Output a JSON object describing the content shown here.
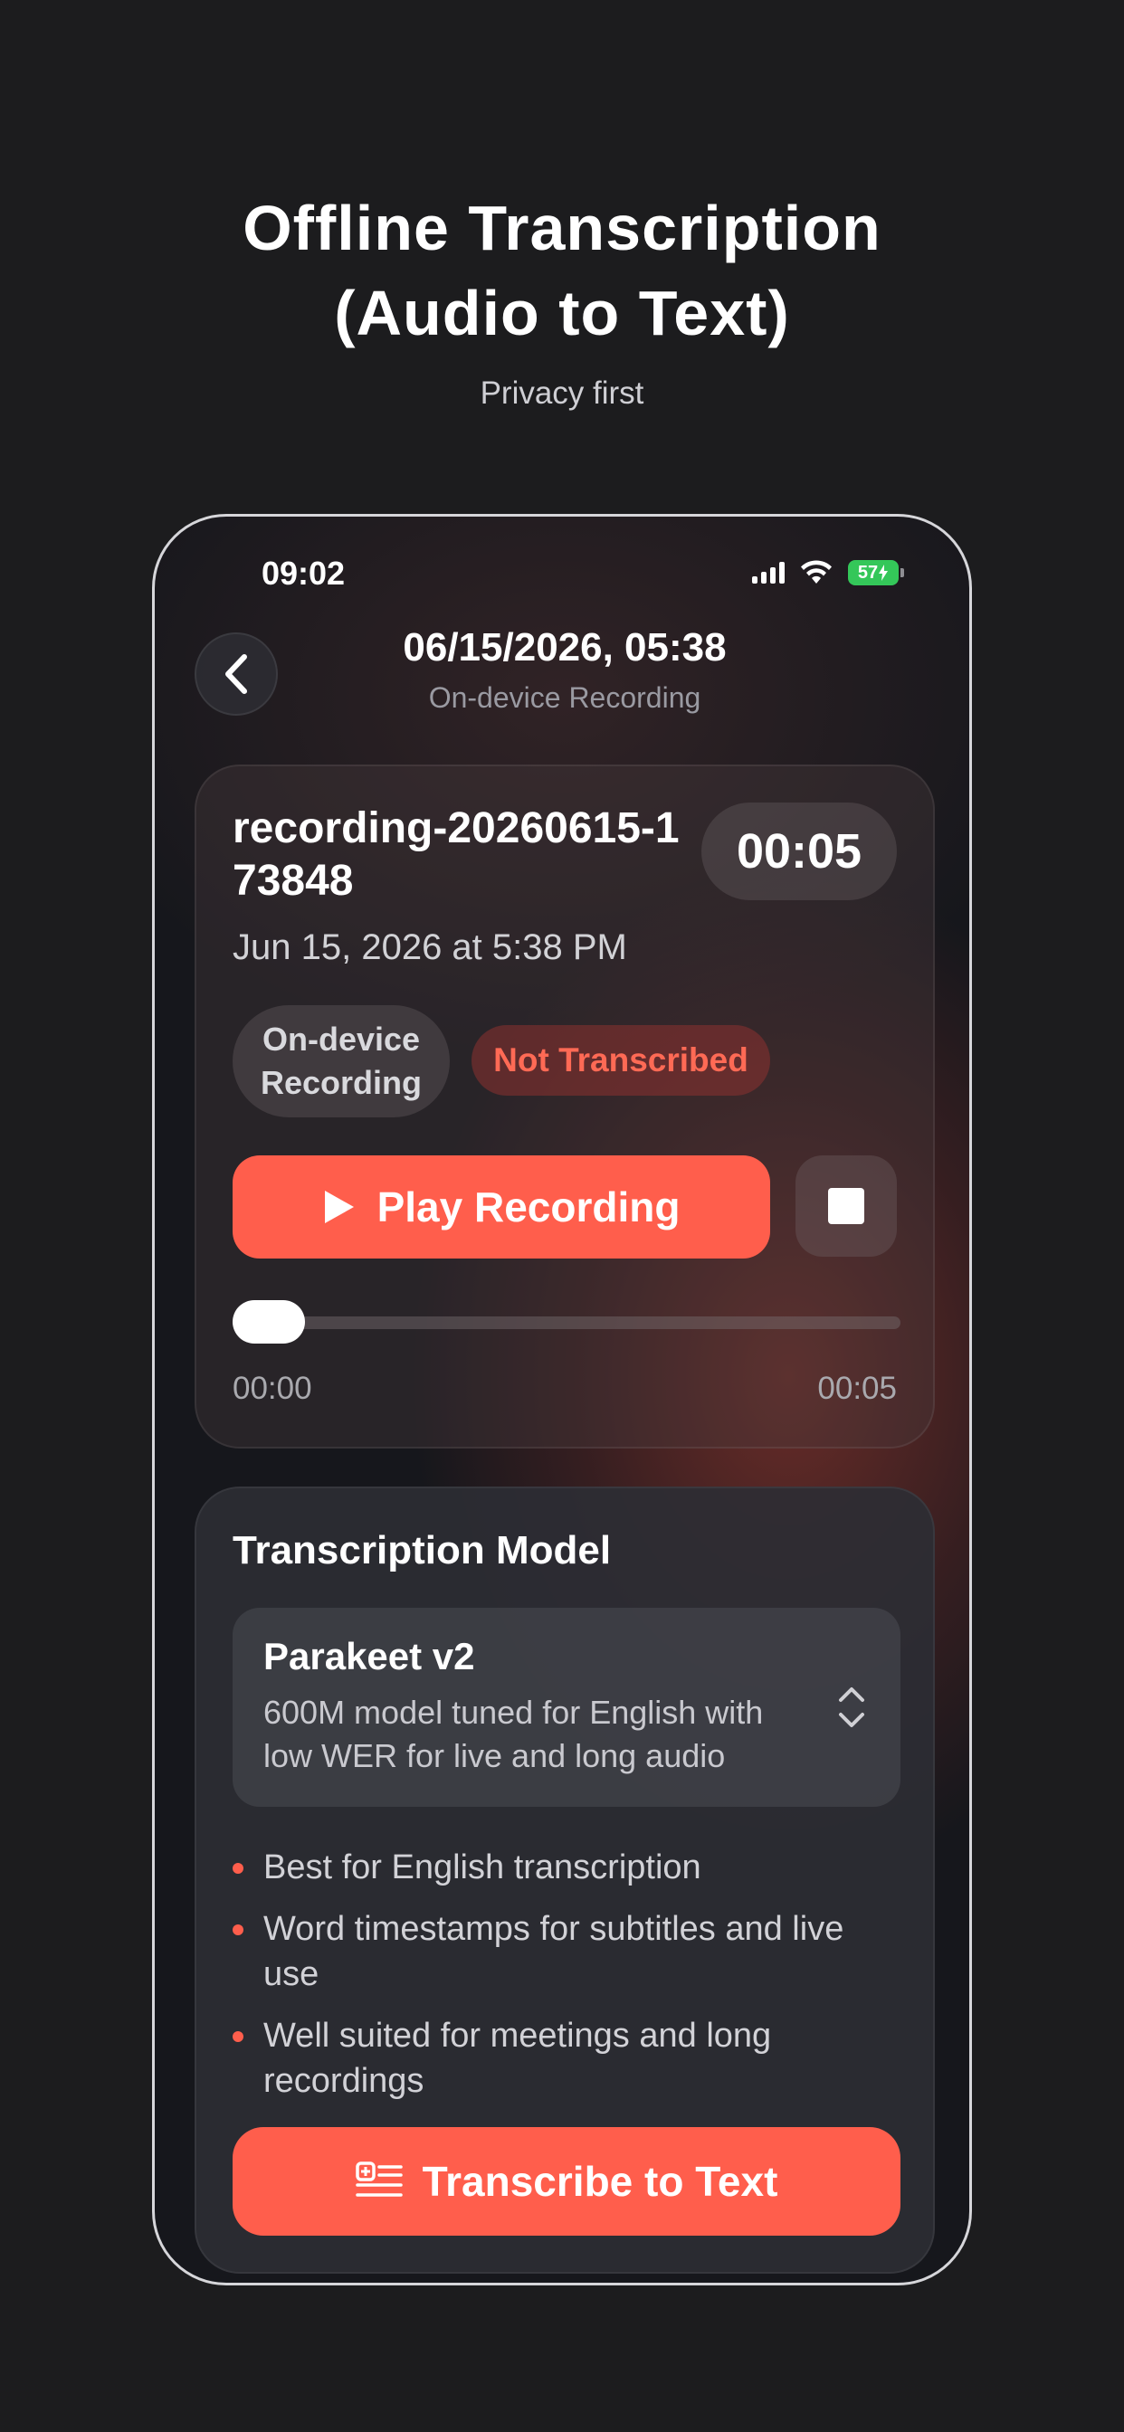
{
  "promo": {
    "title_line1": "Offline Transcription",
    "title_line2": "(Audio to Text)",
    "subtitle": "Privacy first"
  },
  "status_bar": {
    "time": "09:02",
    "battery": "57",
    "icons": [
      "cellular-signal-icon",
      "wifi-icon",
      "battery-charging-icon"
    ]
  },
  "header": {
    "title": "06/15/2026, 05:38",
    "subtitle": "On-device Recording",
    "back_icon": "chevron-left-icon"
  },
  "recording": {
    "name": "recording-20260615-173848",
    "duration": "00:05",
    "date": "Jun 15, 2026 at 5:38 PM",
    "source_tag": "On-device Recording",
    "status_tag": "Not Transcribed",
    "play_label": "Play Recording",
    "play_icon": "play-icon",
    "stop_icon": "stop-icon",
    "elapsed": "00:00",
    "total": "00:05",
    "progress": 0
  },
  "model": {
    "heading": "Transcription Model",
    "selected_name": "Parakeet v2",
    "selected_desc": "600M model tuned for English with low WER for live and long audio",
    "features": [
      "Best for English transcription",
      "Word timestamps for subtitles and live use",
      "Well suited for meetings and long recordings"
    ],
    "transcribe_label": "Transcribe to Text",
    "transcribe_icon": "transcribe-icon"
  },
  "colors": {
    "accent": "#ff5e4c",
    "background": "#1c1c1e",
    "battery": "#34c759"
  }
}
